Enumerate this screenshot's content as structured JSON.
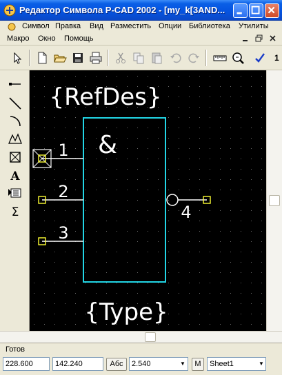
{
  "window": {
    "title": "Редактор Символа P-CAD 2002 - [my_k[3AND..."
  },
  "menu": {
    "row1": [
      "Символ",
      "Правка",
      "Вид",
      "Разместить",
      "Опции",
      "Библиотека",
      "Утилиты"
    ],
    "row2": [
      "Макро",
      "Окно",
      "Помощь"
    ]
  },
  "toolbar": {
    "buttons": [
      "select-arrow",
      "new-file",
      "open-folder",
      "save",
      "print",
      "cut",
      "copy",
      "paste",
      "undo",
      "redo",
      "ruler",
      "zoom",
      "check"
    ],
    "trailing_text": "1"
  },
  "palette": {
    "tools": [
      "place-pin-icon",
      "place-line-icon",
      "place-arc-icon",
      "place-polygon-icon",
      "place-field-icon",
      "place-text-icon",
      "place-attribute-icon",
      "sum-icon"
    ],
    "text_tool_label": "A",
    "sum_tool_label": "Σ"
  },
  "symbol": {
    "refdes": "{RefDes}",
    "type": "{Type}",
    "gate_symbol": "&",
    "pins": [
      {
        "number": "1",
        "side": "left"
      },
      {
        "number": "2",
        "side": "left"
      },
      {
        "number": "3",
        "side": "left"
      },
      {
        "number": "4",
        "side": "right",
        "inverted": true
      }
    ]
  },
  "colors": {
    "canvas_bg": "#000000",
    "body_outline": "#22d6e6",
    "pin_line": "#ffffff",
    "pin_marker": "#ffff33",
    "text": "#ffffff",
    "grid_dot": "#6a6a6a",
    "titlebar": "#0554e0"
  },
  "status": {
    "message": "Готов",
    "x_coord": "228.600",
    "y_coord": "142.240",
    "abs_button": "Абс",
    "grid_value": "2.540",
    "m_button": "M",
    "sheet": "Sheet1"
  }
}
